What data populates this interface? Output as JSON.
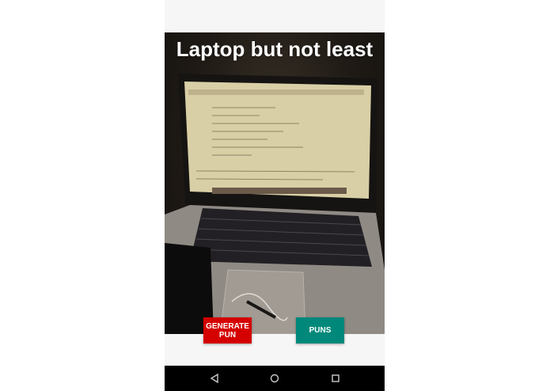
{
  "photo": {
    "caption": "Laptop but not least"
  },
  "buttons": {
    "generate_label": "GENERATE\nPUN",
    "puns_label": "PUNS"
  },
  "nav": {
    "back_icon": "back-triangle-icon",
    "home_icon": "home-circle-icon",
    "recents_icon": "recents-square-icon"
  },
  "colors": {
    "generate_button": "#d50000",
    "puns_button": "#00897b",
    "navbar": "#000000"
  }
}
